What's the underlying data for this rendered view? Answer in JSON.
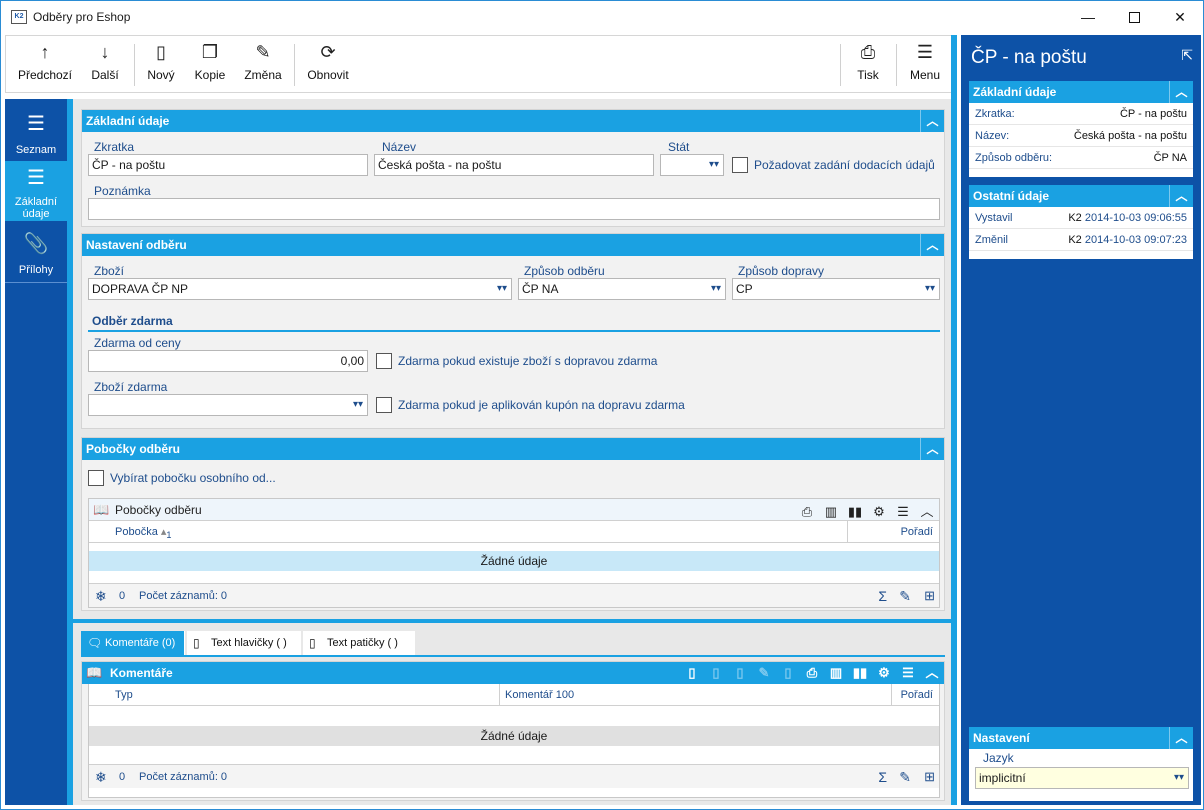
{
  "window": {
    "title": "Odběry pro Eshop",
    "app_badge": "K2"
  },
  "toolbar": {
    "prev": "Předchozí",
    "next": "Další",
    "new": "Nový",
    "copy": "Kopie",
    "change": "Změna",
    "refresh": "Obnovit",
    "print": "Tisk",
    "menu": "Menu"
  },
  "left_tabs": {
    "list": "Seznam",
    "basic": "Základní údaje",
    "attachments": "Přílohy"
  },
  "basic": {
    "title": "Základní údaje",
    "abbr_label": "Zkratka",
    "abbr_value": "ČP - na poštu",
    "name_label": "Název",
    "name_value": "Česká pošta - na poštu",
    "state_label": "Stát",
    "state_value": "",
    "require_delivery_label": "Požadovat zadání dodacích údajů",
    "note_label": "Poznámka",
    "note_value": ""
  },
  "settings": {
    "title": "Nastavení odběru",
    "goods_label": "Zboží",
    "goods_value": "DOPRAVA ČP NP",
    "pickup_label": "Způsob odběru",
    "pickup_value": "ČP NA",
    "transport_label": "Způsob dopravy",
    "transport_value": "CP",
    "free_title": "Odběr zdarma",
    "free_from_label": "Zdarma od ceny",
    "free_from_value": "0,00",
    "free_if_goods_label": "Zdarma pokud existuje zboží s dopravou zdarma",
    "free_goods_label": "Zboží zdarma",
    "free_goods_value": "",
    "free_if_coupon_label": "Zdarma pokud je aplikován kupón na dopravu zdarma"
  },
  "branches": {
    "title": "Pobočky odběru",
    "select_branch_label": "Vybírat pobočku osobního od...",
    "grid_title": "Pobočky odběru",
    "col_branch": "Pobočka",
    "sort_marker": "1",
    "col_order": "Pořadí",
    "empty": "Žádné údaje",
    "count": "0",
    "records_label": "Počet záznamů: 0"
  },
  "bottom_tabs": [
    {
      "label": "Komentáře (0)"
    },
    {
      "label": "Text hlavičky ( )"
    },
    {
      "label": "Text patičky ( )"
    }
  ],
  "comments": {
    "title": "Komentáře",
    "col_type": "Typ",
    "col_comment": "Komentář 100",
    "col_order": "Pořadí",
    "empty": "Žádné údaje",
    "count": "0",
    "records_label": "Počet záznamů: 0"
  },
  "right": {
    "title": "ČP - na poštu",
    "basic_title": "Základní údaje",
    "basic_rows": [
      {
        "k": "Zkratka:",
        "v": "ČP - na poštu"
      },
      {
        "k": "Název:",
        "v": "Česká pošta - na poštu"
      },
      {
        "k": "Způsob odběru:",
        "v": "ČP NA"
      }
    ],
    "other_title": "Ostatní údaje",
    "other_rows": [
      {
        "k": "Vystavil",
        "u": "K2",
        "d": "2014-10-03 09:06:55"
      },
      {
        "k": "Změnil",
        "u": "K2",
        "d": "2014-10-03 09:07:23"
      }
    ],
    "settings_title": "Nastavení",
    "lang_label": "Jazyk",
    "lang_value": "implicitní"
  }
}
